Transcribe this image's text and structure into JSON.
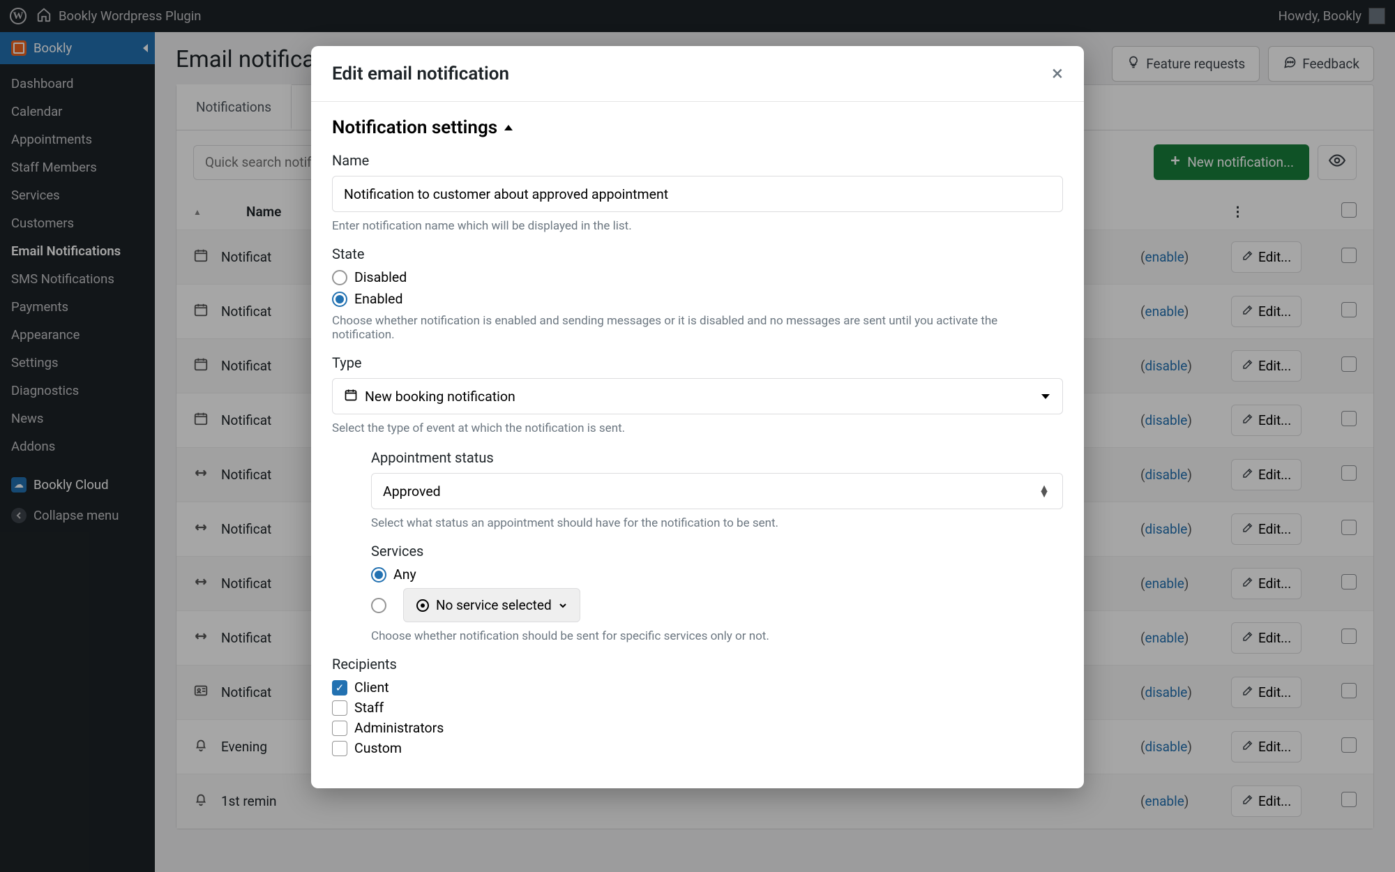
{
  "topbar": {
    "site_title": "Bookly Wordpress Plugin",
    "howdy": "Howdy, Bookly"
  },
  "sidebar": {
    "brand": "Bookly",
    "items": [
      "Dashboard",
      "Calendar",
      "Appointments",
      "Staff Members",
      "Services",
      "Customers",
      "Email Notifications",
      "SMS Notifications",
      "Payments",
      "Appearance",
      "Settings",
      "Diagnostics",
      "News",
      "Addons"
    ],
    "active_index": 6,
    "cloud": "Bookly Cloud",
    "collapse": "Collapse menu"
  },
  "header": {
    "title": "Email notifications",
    "feature_requests": "Feature requests",
    "feedback": "Feedback"
  },
  "tabs": {
    "t0": "Notifications"
  },
  "toolbar": {
    "search_placeholder": "Quick search notification",
    "new_btn": "New notification...",
    "name_col": "Name",
    "edit_btn": "Edit..."
  },
  "rows": [
    {
      "icon": "cal",
      "status": "enable"
    },
    {
      "icon": "cal",
      "status": "enable"
    },
    {
      "icon": "cal",
      "status": "disable"
    },
    {
      "icon": "cal",
      "status": "disable"
    },
    {
      "icon": "arr",
      "status": "disable"
    },
    {
      "icon": "arr",
      "status": "disable"
    },
    {
      "icon": "arr",
      "status": "enable"
    },
    {
      "icon": "arr",
      "status": "enable"
    },
    {
      "icon": "id",
      "status": "disable"
    },
    {
      "icon": "bell",
      "status": "disable"
    },
    {
      "icon": "bell",
      "status": "enable"
    }
  ],
  "row_name_prefix": "Notificat",
  "row_names_special": {
    "9": "Evening",
    "10": "1st remin"
  },
  "modal": {
    "title": "Edit email notification",
    "section": "Notification settings",
    "name_label": "Name",
    "name_value": "Notification to customer about approved appointment",
    "name_hint": "Enter notification name which will be displayed in the list.",
    "state_label": "State",
    "state_disabled": "Disabled",
    "state_enabled": "Enabled",
    "state_hint": "Choose whether notification is enabled and sending messages or it is disabled and no messages are sent until you activate the notification.",
    "type_label": "Type",
    "type_value": "New booking notification",
    "type_hint": "Select the type of event at which the notification is sent.",
    "appt_status_label": "Appointment status",
    "appt_status_value": "Approved",
    "appt_status_hint": "Select what status an appointment should have for the notification to be sent.",
    "services_label": "Services",
    "services_any": "Any",
    "services_none": "No service selected",
    "services_hint": "Choose whether notification should be sent for specific services only or not.",
    "recipients_label": "Recipients",
    "rcp_client": "Client",
    "rcp_staff": "Staff",
    "rcp_admins": "Administrators",
    "rcp_custom": "Custom"
  }
}
